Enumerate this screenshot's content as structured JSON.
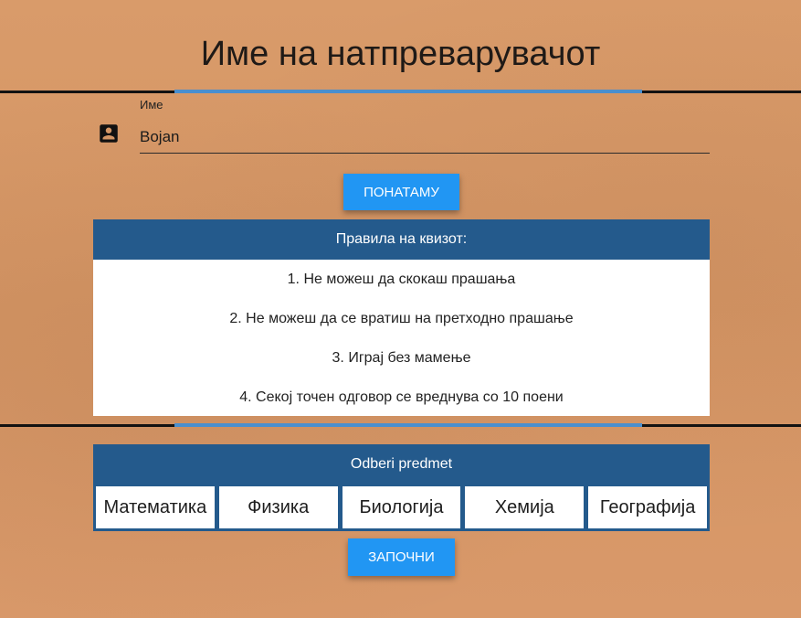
{
  "header": {
    "title": "Име на натпреварувачот"
  },
  "name_field": {
    "label": "Име",
    "value": "Bojan",
    "icon": "account-box-icon"
  },
  "next_button": {
    "label": "ПОНАТАМУ"
  },
  "rules": {
    "title": "Правила на квизот:",
    "items": [
      "1. Не можеш да скокаш прашања",
      "2. Не можеш да се вратиш на претходно прашање",
      "3. Играј без мамење",
      "4. Секој точен одговор се вреднува со 10 поени"
    ]
  },
  "subjects": {
    "title": "Odberi predmet",
    "items": [
      "Математика",
      "Физика",
      "Биологија",
      "Хемија",
      "Географија"
    ]
  },
  "start_button": {
    "label": "ЗАПОЧНИ"
  },
  "colors": {
    "background": "#d59766",
    "header_blue": "#245a8c",
    "button_blue": "#2196f3",
    "accent_blue": "#4a8fce"
  }
}
